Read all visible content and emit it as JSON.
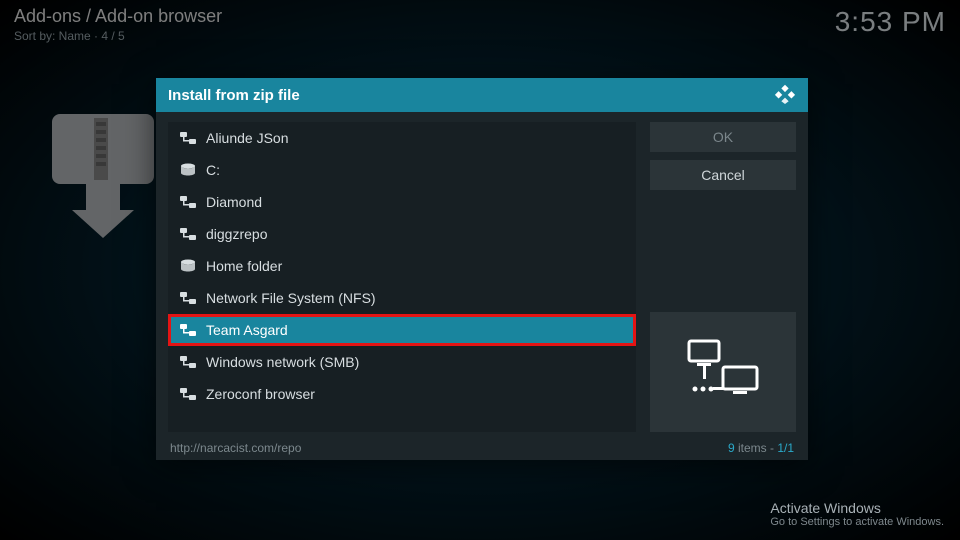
{
  "breadcrumb": {
    "main": "Add-ons / Add-on browser",
    "sub": "Sort by: Name  ·  4 / 5"
  },
  "clock": "3:53 PM",
  "dialog": {
    "title": "Install from zip file",
    "items": [
      {
        "label": "Aliunde JSon",
        "icon": "net"
      },
      {
        "label": "C:",
        "icon": "disk"
      },
      {
        "label": "Diamond",
        "icon": "net"
      },
      {
        "label": "diggzrepo",
        "icon": "net"
      },
      {
        "label": "Home folder",
        "icon": "disk"
      },
      {
        "label": "Network File System (NFS)",
        "icon": "net"
      },
      {
        "label": "Team Asgard",
        "icon": "net",
        "selected": true,
        "highlight": true
      },
      {
        "label": "Windows network (SMB)",
        "icon": "net"
      },
      {
        "label": "Zeroconf browser",
        "icon": "net"
      }
    ],
    "ok": "OK",
    "cancel": "Cancel",
    "path": "http://narcacist.com/repo",
    "count": "9",
    "count_word": " items - ",
    "page": "1/1"
  },
  "watermark": {
    "title": "Activate Windows",
    "sub": "Go to Settings to activate Windows."
  }
}
